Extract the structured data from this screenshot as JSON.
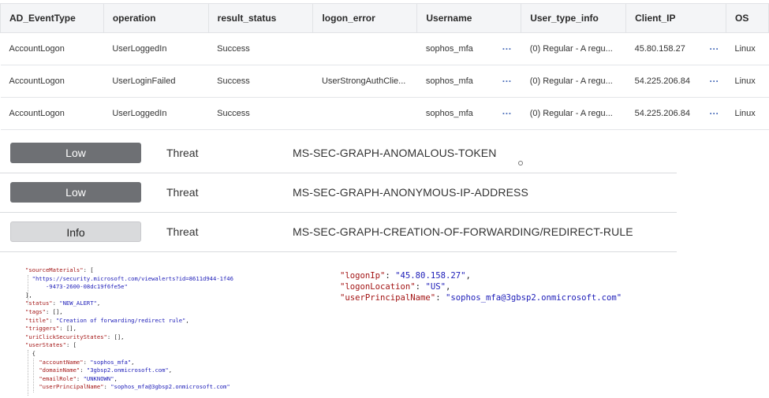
{
  "table": {
    "headers": [
      "AD_EventType",
      "operation",
      "result_status",
      "logon_error",
      "Username",
      "",
      "User_type_info",
      "Client_IP",
      "",
      "OS"
    ],
    "rows": [
      [
        "AccountLogon",
        "UserLoggedIn",
        "Success",
        "",
        "sophos_mfa",
        "···",
        "(0) Regular - A regu...",
        "45.80.158.27",
        "···",
        "Linux"
      ],
      [
        "AccountLogon",
        "UserLoginFailed",
        "Success",
        "UserStrongAuthClie...",
        "sophos_mfa",
        "···",
        "(0) Regular - A regu...",
        "54.225.206.84",
        "···",
        "Linux"
      ],
      [
        "AccountLogon",
        "UserLoggedIn",
        "Success",
        "",
        "sophos_mfa",
        "···",
        "(0) Regular - A regu...",
        "54.225.206.84",
        "···",
        "Linux"
      ]
    ]
  },
  "alerts": [
    {
      "severity": "Low",
      "type": "Threat",
      "name": "MS-SEC-GRAPH-ANOMALOUS-TOKEN"
    },
    {
      "severity": "Low",
      "type": "Threat",
      "name": "MS-SEC-GRAPH-ANONYMOUS-IP-ADDRESS"
    },
    {
      "severity": "Info",
      "type": "Threat",
      "name": "MS-SEC-GRAPH-CREATION-OF-FORWARDING/REDIRECT-RULE"
    }
  ],
  "json_left": {
    "l1_key": "\"sourceMaterials\"",
    "l1_rest": ": [",
    "l2": "\"https://security.microsoft.com/viewalerts?id=8611d944-1f46",
    "l3": "-9473-2600-08dc19f6fe5e\"",
    "l4": "],",
    "l5_key": "\"status\"",
    "l5_val": "\"NEW_ALERT\"",
    "l6_key": "\"tags\"",
    "l6_val": "[],",
    "l7_key": "\"title\"",
    "l7_val": "\"Creation of forwarding/redirect rule\"",
    "l8_key": "\"triggers\"",
    "l8_val": "[],",
    "l9_key": "\"uriClickSecurityStates\"",
    "l9_val": "[],",
    "l10_key": "\"userStates\"",
    "l10_val": "[",
    "l11": "{",
    "l12_key": "\"accountName\"",
    "l12_val": "\"sophos_mfa\"",
    "l13_key": "\"domainName\"",
    "l13_val": "\"3gbsp2.onmicrosoft.com\"",
    "l14_key": "\"emailRole\"",
    "l14_val": "\"UNKNOWN\"",
    "l15_key": "\"userPrincipalName\"",
    "l15_val": "\"sophos_mfa@3gbsp2.onmicrosoft.com\""
  },
  "json_right": {
    "r1_key": "\"logonIp\"",
    "r1_val": "\"45.80.158.27\"",
    "r2_key": "\"logonLocation\"",
    "r2_val": "\"US\"",
    "r3_key": "\"userPrincipalName\"",
    "r3_val": "\"sophos_mfa@3gbsp2.onmicrosoft.com\""
  }
}
